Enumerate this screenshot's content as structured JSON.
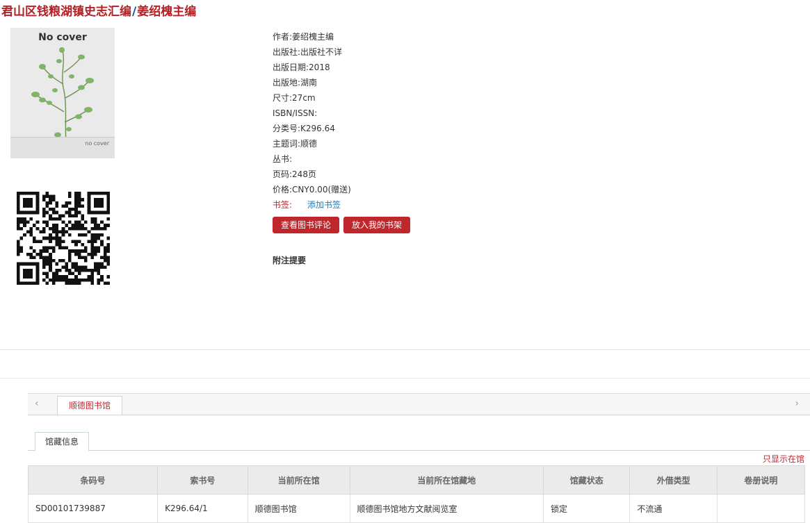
{
  "title": {
    "main": "君山区钱粮湖镇史志汇编",
    "separator": "/",
    "author": "姜绍槐主编"
  },
  "cover": {
    "label": "No cover",
    "footer_text": "no cover"
  },
  "meta": [
    {
      "label": "作者:",
      "value": "姜绍槐主编"
    },
    {
      "label": "出版社:",
      "value": "出版社不详"
    },
    {
      "label": "出版日期:",
      "value": "2018"
    },
    {
      "label": "出版地:",
      "value": "湖南"
    },
    {
      "label": "尺寸:",
      "value": "27cm"
    },
    {
      "label": "ISBN/ISSN:",
      "value": ""
    },
    {
      "label": "分类号:",
      "value": "K296.64"
    },
    {
      "label": "主题词:",
      "value": "顺德"
    },
    {
      "label": "丛书:",
      "value": ""
    },
    {
      "label": "页码:",
      "value": "248页"
    },
    {
      "label": "价格:",
      "value": "CNY0.00(赠送)"
    }
  ],
  "bookmark": {
    "label": "书签:",
    "link": "添加书签"
  },
  "buttons": {
    "review": "查看图书评论",
    "shelf": "放入我的书架"
  },
  "notes_heading": "附注提要",
  "library_tabs": {
    "active": "顺德图书馆",
    "left_arrow": "‹",
    "right_arrow": "›"
  },
  "holdings_tab": "馆藏信息",
  "only_available_link": "只显示在馆",
  "table": {
    "headers": [
      "条码号",
      "索书号",
      "当前所在馆",
      "当前所在馆藏地",
      "馆藏状态",
      "外借类型",
      "卷册说明"
    ],
    "rows": [
      [
        "SD00101739887",
        "K296.64/1",
        "顺德图书馆",
        "顺德图书馆地方文献阅览室",
        "锁定",
        "不流通",
        ""
      ]
    ]
  },
  "colors": {
    "accent_red": "#c0272d",
    "link_blue": "#1a7bb9",
    "separator_blue": "#1f4f8f"
  }
}
